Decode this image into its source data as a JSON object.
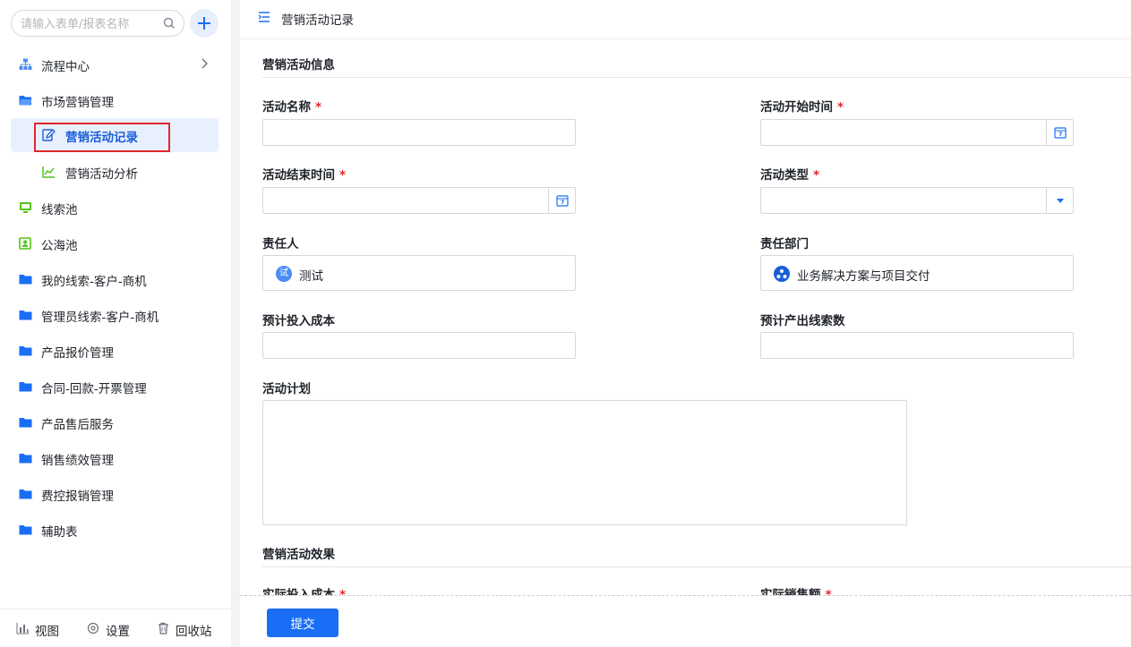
{
  "sidebar": {
    "search_placeholder": "请输入表单/报表名称",
    "items": [
      {
        "label": "流程中心"
      },
      {
        "label": "市场营销管理"
      },
      {
        "label": "营销活动记录"
      },
      {
        "label": "营销活动分析"
      },
      {
        "label": "线索池"
      },
      {
        "label": "公海池"
      },
      {
        "label": "我的线索-客户-商机"
      },
      {
        "label": "管理员线索-客户-商机"
      },
      {
        "label": "产品报价管理"
      },
      {
        "label": "合同-回款-开票管理"
      },
      {
        "label": "产品售后服务"
      },
      {
        "label": "销售绩效管理"
      },
      {
        "label": "费控报销管理"
      },
      {
        "label": "辅助表"
      }
    ],
    "footer": {
      "view": "视图",
      "settings": "设置",
      "recycle": "回收站"
    }
  },
  "header": {
    "title": "营销活动记录"
  },
  "form": {
    "section1": "营销活动信息",
    "section2": "营销活动效果",
    "required_mark": "*",
    "fields": {
      "activity_name": {
        "label": "活动名称",
        "value": ""
      },
      "start_time": {
        "label": "活动开始时间",
        "value": ""
      },
      "end_time": {
        "label": "活动结束时间",
        "value": ""
      },
      "activity_type": {
        "label": "活动类型",
        "value": ""
      },
      "owner": {
        "label": "责任人",
        "value": "测试",
        "avatar": "试"
      },
      "department": {
        "label": "责任部门",
        "value": "业务解决方案与项目交付"
      },
      "planned_cost": {
        "label": "预计投入成本",
        "value": ""
      },
      "expected_leads": {
        "label": "预计产出线索数",
        "value": ""
      },
      "plan": {
        "label": "活动计划",
        "value": ""
      },
      "actual_cost": {
        "label": "实际投入成本"
      },
      "actual_sales": {
        "label": "实际销售额"
      }
    },
    "submit": "提交"
  },
  "colors": {
    "accent": "#1a6ef5",
    "required": "#e0262d",
    "active_bg": "#e9f0fd",
    "folder": "#1a6ef5",
    "green_icon": "#52c41a"
  }
}
